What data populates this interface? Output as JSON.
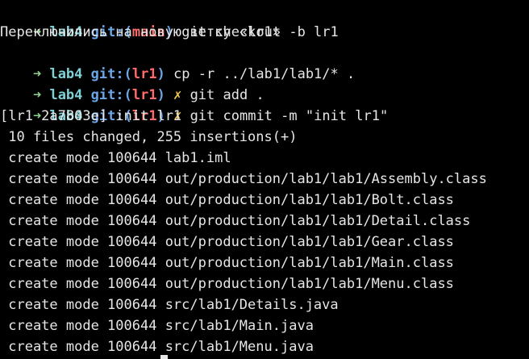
{
  "colors": {
    "background": "#000000",
    "text": "#e6e6e6",
    "arrow": "#8fd18f",
    "dir": "#7fd1d6",
    "git": "#6aa6e8",
    "branch": "#ff6b6b",
    "dirty": "#f3c94b"
  },
  "prompt": {
    "arrow": "➜",
    "dir": "lab4",
    "git_open": "git:(",
    "git_close": ")",
    "dirty_mark": "✗"
  },
  "commands": [
    {
      "branch": "main",
      "dirty": false,
      "text": "git checkout -b lr1"
    },
    {
      "branch": "lr1",
      "dirty": false,
      "text": "cp -r ../lab1/lab1/* ."
    },
    {
      "branch": "lr1",
      "dirty": true,
      "text": "git add ."
    },
    {
      "branch": "lr1",
      "dirty": true,
      "text": "git commit -m \"init lr1\""
    }
  ],
  "outputs": {
    "switched": "Переключились на новую ветку «lr1»",
    "commit_header": "[lr1 2a7803e] init lr1",
    "summary": " 10 files changed, 255 insertions(+)",
    "create_lines": [
      " create mode 100644 lab1.iml",
      " create mode 100644 out/production/lab1/lab1/Assembly.class",
      " create mode 100644 out/production/lab1/lab1/Bolt.class",
      " create mode 100644 out/production/lab1/lab1/Detail.class",
      " create mode 100644 out/production/lab1/lab1/Gear.class",
      " create mode 100644 out/production/lab1/lab1/Main.class",
      " create mode 100644 out/production/lab1/lab1/Menu.class",
      " create mode 100644 src/lab1/Details.java",
      " create mode 100644 src/lab1/Main.java",
      " create mode 100644 src/lab1/Menu.java"
    ]
  }
}
